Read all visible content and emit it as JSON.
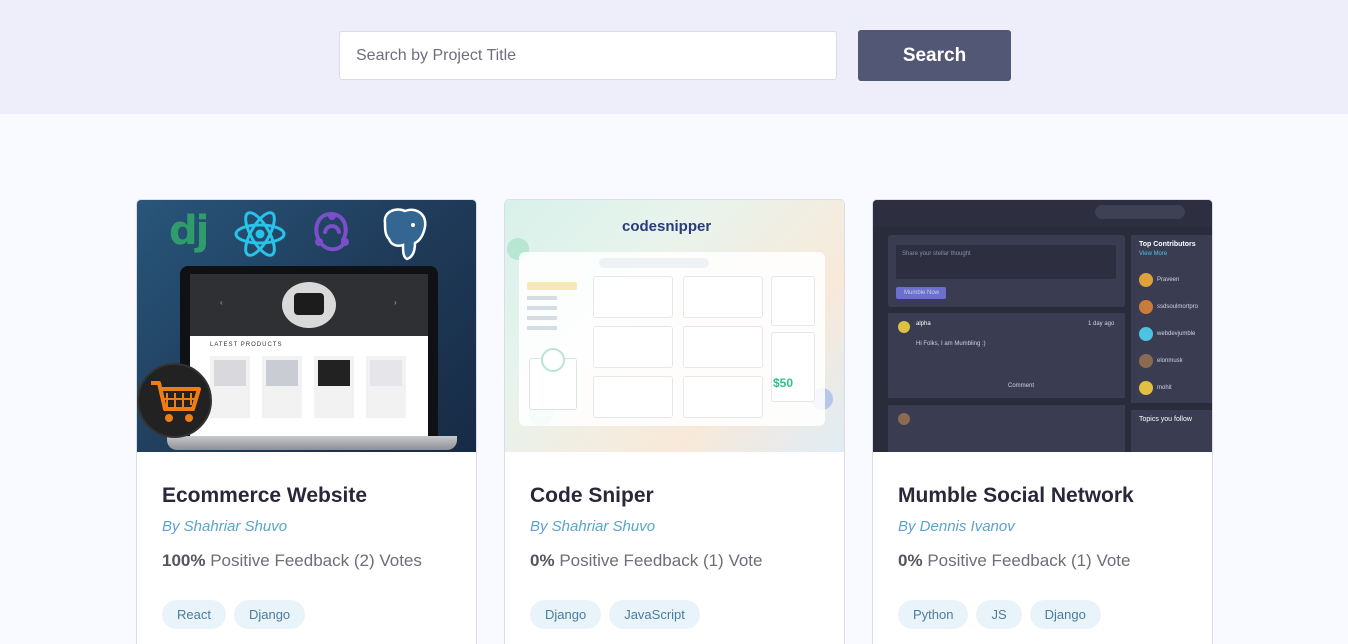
{
  "search": {
    "placeholder": "Search by Project Title",
    "button_label": "Search"
  },
  "projects": [
    {
      "title": "Ecommerce Website",
      "author": "By Shahriar Shuvo",
      "feedback_percent": "100%",
      "feedback_text": "Positive Feedback (2) Votes",
      "tags": [
        "React",
        "Django"
      ],
      "thumbnail": {
        "logo_text": "dj",
        "section_label": "LATEST PRODUCTS"
      }
    },
    {
      "title": "Code Sniper",
      "author": "By Shahriar Shuvo",
      "feedback_percent": "0%",
      "feedback_text": "Positive Feedback (1) Vote",
      "tags": [
        "Django",
        "JavaScript"
      ],
      "thumbnail": {
        "brand": "codesnipper",
        "price": "$50"
      }
    },
    {
      "title": "Mumble Social Network",
      "author": "By Dennis Ivanov",
      "feedback_percent": "0%",
      "feedback_text": "Positive Feedback (1) Vote",
      "tags": [
        "Python",
        "JS",
        "Django"
      ],
      "thumbnail": {
        "sidebar_title": "Top Contributors",
        "sidebar_link": "View More",
        "contributors": [
          "Praveen",
          "ssdsoulmortpro",
          "webdevjumble",
          "elonmusk",
          "mohit"
        ],
        "post_author": "alpha",
        "post_text": "Hi Folks, I am Mumbling :)",
        "post_time": "1 day ago",
        "compose_placeholder": "Share your stellar thought",
        "compose_button": "Mumble Now",
        "comment_label": "Comment",
        "topics_title": "Topics you follow"
      }
    }
  ],
  "colors": {
    "header_bg": "#eeeefb",
    "button_bg": "#525776",
    "author_color": "#5aa3c9",
    "tag_bg": "#e8f4fa"
  }
}
